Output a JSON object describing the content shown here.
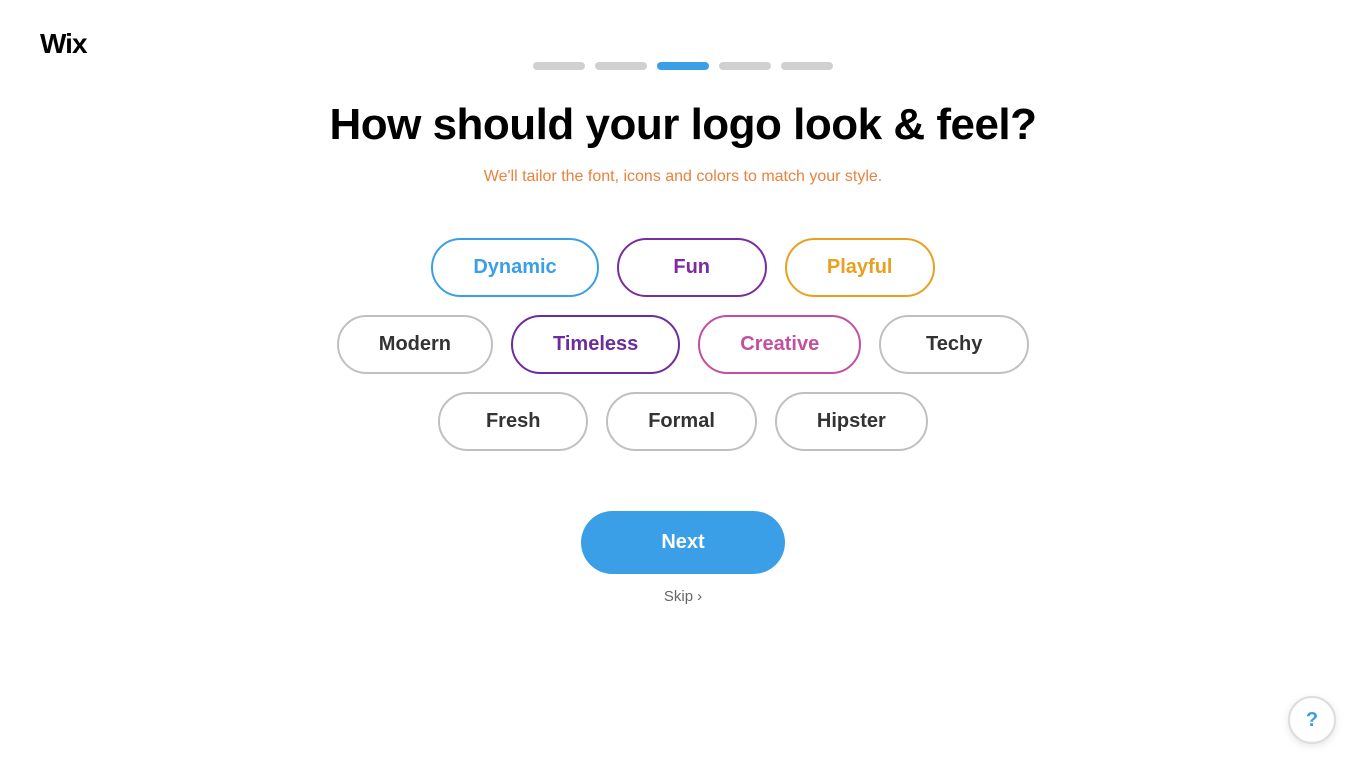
{
  "logo": {
    "text": "Wix"
  },
  "progress": {
    "steps": [
      {
        "id": 1,
        "active": false
      },
      {
        "id": 2,
        "active": false
      },
      {
        "id": 3,
        "active": true
      },
      {
        "id": 4,
        "active": false
      },
      {
        "id": 5,
        "active": false
      }
    ]
  },
  "page": {
    "title": "How should your logo look & feel?",
    "subtitle": "We'll tailor the font, icons and colors to match your style."
  },
  "options": {
    "row1": [
      {
        "id": "dynamic",
        "label": "Dynamic",
        "style": "dynamic"
      },
      {
        "id": "fun",
        "label": "Fun",
        "style": "fun"
      },
      {
        "id": "playful",
        "label": "Playful",
        "style": "playful"
      }
    ],
    "row2": [
      {
        "id": "modern",
        "label": "Modern",
        "style": "modern"
      },
      {
        "id": "timeless",
        "label": "Timeless",
        "style": "timeless"
      },
      {
        "id": "creative",
        "label": "Creative",
        "style": "creative"
      },
      {
        "id": "techy",
        "label": "Techy",
        "style": "techy"
      }
    ],
    "row3": [
      {
        "id": "fresh",
        "label": "Fresh",
        "style": "fresh"
      },
      {
        "id": "formal",
        "label": "Formal",
        "style": "formal"
      },
      {
        "id": "hipster",
        "label": "Hipster",
        "style": "hipster"
      }
    ]
  },
  "buttons": {
    "next": "Next",
    "skip": "Skip",
    "skip_chevron": "›"
  },
  "help": {
    "icon": "?"
  }
}
